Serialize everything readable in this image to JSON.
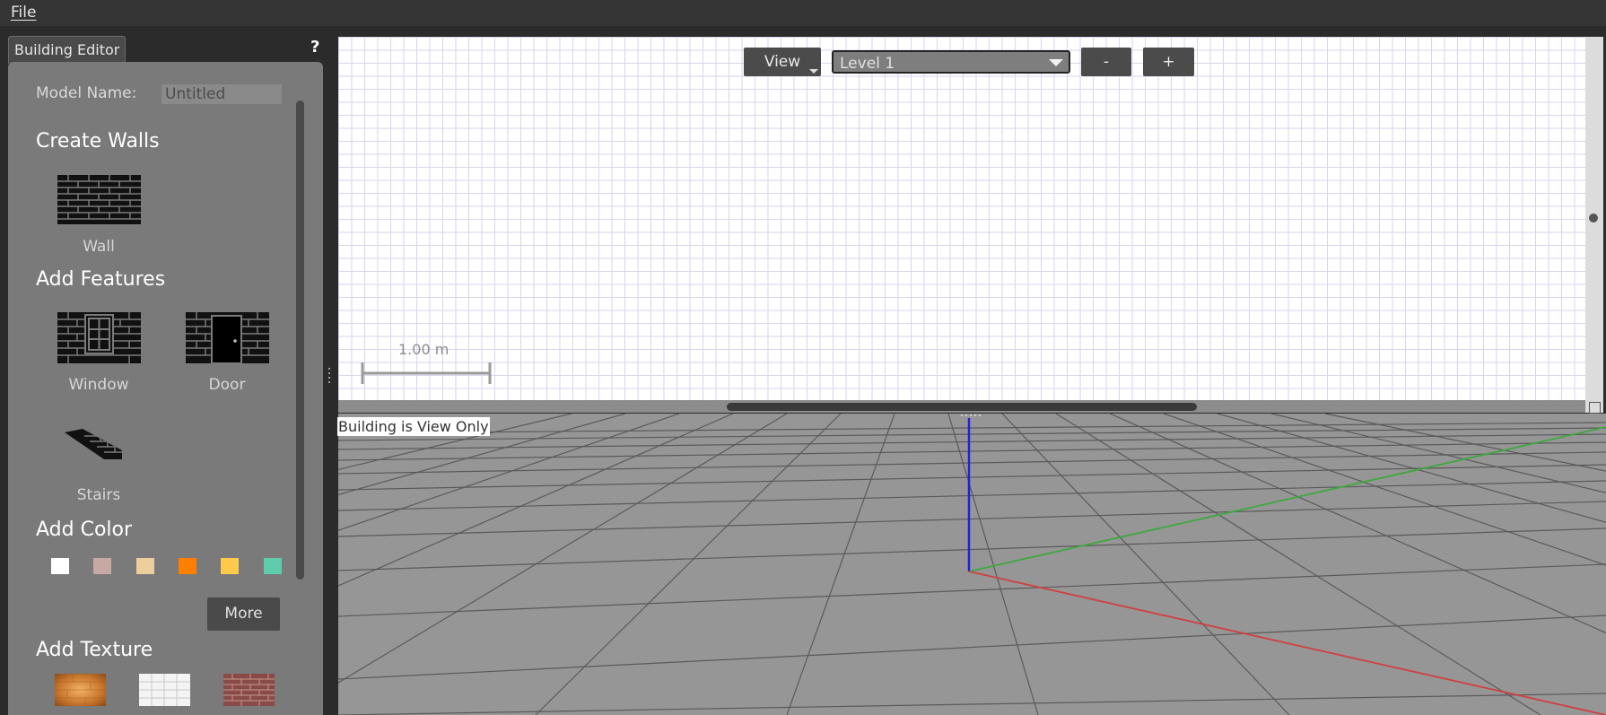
{
  "menubar": {
    "file_label": "File"
  },
  "panel": {
    "tab_label": "Building Editor",
    "help_label": "?",
    "model_name_label": "Model Name:",
    "model_name_value": "Untitled",
    "create_walls": {
      "heading": "Create Walls",
      "wall_label": "Wall"
    },
    "add_features": {
      "heading": "Add Features",
      "window_label": "Window",
      "door_label": "Door",
      "stairs_label": "Stairs"
    },
    "add_color": {
      "heading": "Add Color",
      "swatches": [
        "#ffffff",
        "#c7a9a4",
        "#edcf9e",
        "#ff7f00",
        "#ffc94a",
        "#5fccad"
      ],
      "more_label": "More"
    },
    "add_texture": {
      "heading": "Add Texture",
      "textures": [
        "wood-texture",
        "tiles-texture",
        "bricks-texture"
      ]
    }
  },
  "view2d": {
    "view_label": "View",
    "level_label": "Level 1",
    "zoom_out_label": "-",
    "zoom_in_label": "+",
    "scale_label": "1.00 m"
  },
  "view3d": {
    "status_label": "Building is View Only",
    "axis_colors": {
      "x": "#d04040",
      "y": "#3ea83e",
      "z": "#2020e0"
    }
  }
}
